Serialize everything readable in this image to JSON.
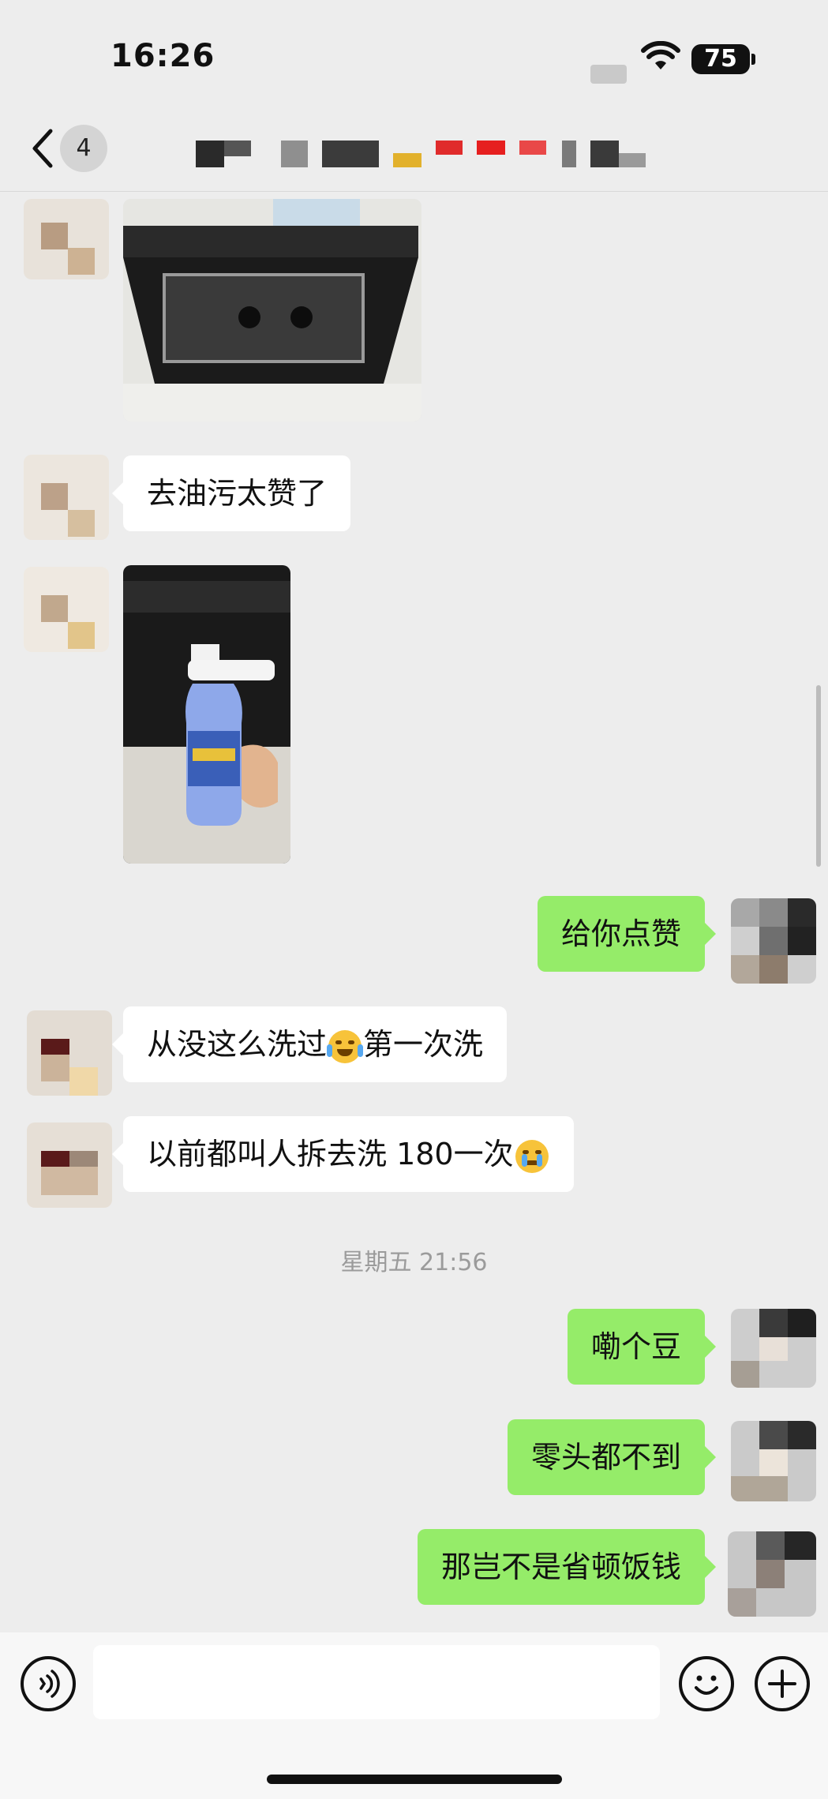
{
  "status_bar": {
    "time": "16:26",
    "battery": "75"
  },
  "nav": {
    "unread_count": "4"
  },
  "messages": [
    {
      "id": "m1",
      "side": "left",
      "type": "image",
      "subject": "range-hood-photo"
    },
    {
      "id": "m2",
      "side": "left",
      "type": "text",
      "text": "去油污太赞了"
    },
    {
      "id": "m3",
      "side": "left",
      "type": "image",
      "subject": "cleaner-spray-bottle-photo"
    },
    {
      "id": "m4",
      "side": "right",
      "type": "text",
      "text": "给你点赞"
    },
    {
      "id": "m5",
      "side": "left",
      "type": "text",
      "text_before": "从没这么洗过",
      "emoji": "joy-tears-emoji",
      "text_after": "第一次洗"
    },
    {
      "id": "m6",
      "side": "left",
      "type": "text",
      "text_before": "以前都叫人拆去洗 180一次",
      "emoji": "crying-emoji"
    },
    {
      "id": "m7",
      "side": "right",
      "type": "text",
      "text": "嘞个豆"
    },
    {
      "id": "m8",
      "side": "right",
      "type": "text",
      "text": "零头都不到"
    },
    {
      "id": "m9",
      "side": "right",
      "type": "text",
      "text": "那岂不是省顿饭钱"
    }
  ],
  "timestamp": "星期五 21:56",
  "input": {
    "value": "",
    "placeholder": ""
  },
  "colors": {
    "background": "#EDEDED",
    "sent_bubble": "#95EC69",
    "received_bubble": "#FFFFFF",
    "timestamp": "#9B9B9B"
  },
  "icons": [
    "back-chevron-icon",
    "voice-icon",
    "emoji-icon",
    "plus-icon",
    "wifi-icon",
    "battery-icon"
  ]
}
